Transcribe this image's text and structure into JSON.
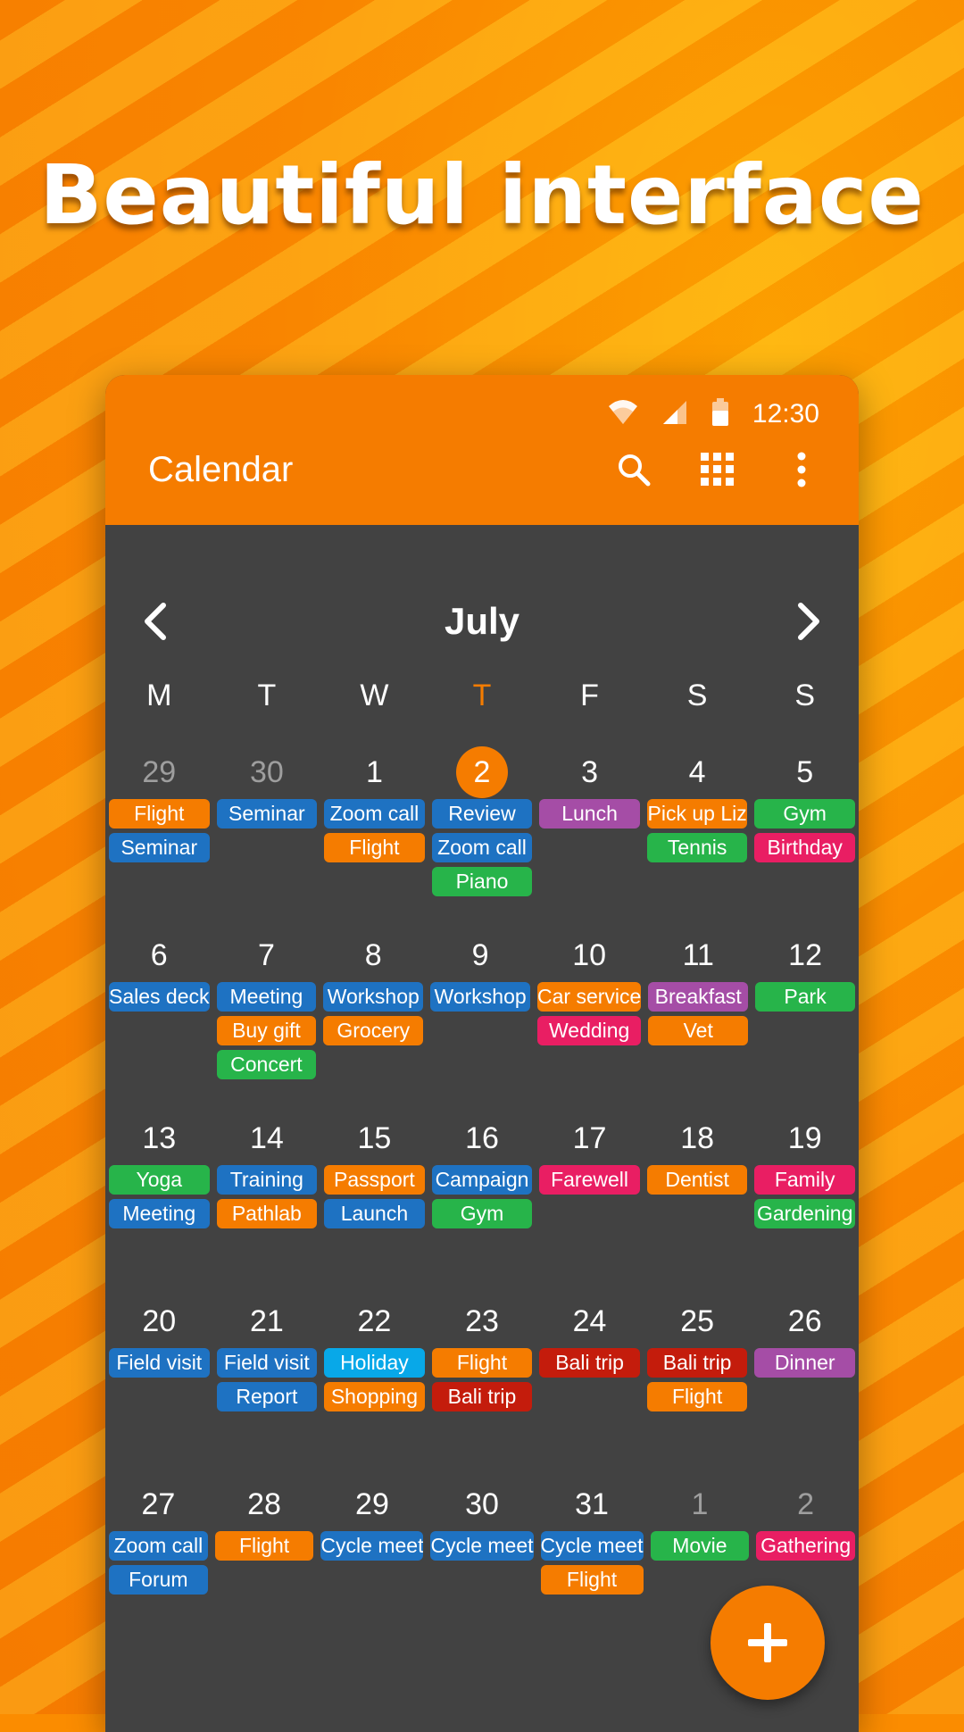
{
  "headline": "Beautiful interface",
  "status_bar": {
    "time": "12:30",
    "icons": [
      "wifi-icon",
      "signal-icon",
      "battery-icon"
    ]
  },
  "app_bar": {
    "title": "Calendar",
    "actions": [
      "search-icon",
      "grid-icon",
      "more-vert-icon"
    ]
  },
  "month": {
    "label": "July",
    "prev_icon": "chevron-left-icon",
    "next_icon": "chevron-right-icon"
  },
  "colors": {
    "accent": "#f57c00",
    "orange": "#f57c00",
    "blue": "#1e72c2",
    "green": "#27b44a",
    "purple": "#a54da6",
    "pink": "#e91e63",
    "red": "#c41c0c",
    "cyan": "#08a8e8",
    "background": "#424242"
  },
  "weekdays": [
    {
      "label": "M",
      "today": false
    },
    {
      "label": "T",
      "today": false
    },
    {
      "label": "W",
      "today": false
    },
    {
      "label": "T",
      "today": true
    },
    {
      "label": "F",
      "today": false
    },
    {
      "label": "S",
      "today": false
    },
    {
      "label": "S",
      "today": false
    }
  ],
  "weeks": [
    [
      {
        "day": "29",
        "muted": true,
        "events": [
          {
            "t": "Flight",
            "c": "orange"
          },
          {
            "t": "Seminar",
            "c": "blue"
          }
        ]
      },
      {
        "day": "30",
        "muted": true,
        "events": [
          {
            "t": "Seminar",
            "c": "blue"
          }
        ]
      },
      {
        "day": "1",
        "events": [
          {
            "t": "Zoom call",
            "c": "blue"
          },
          {
            "t": "Flight",
            "c": "orange"
          }
        ]
      },
      {
        "day": "2",
        "today": true,
        "events": [
          {
            "t": "Review",
            "c": "blue"
          },
          {
            "t": "Zoom call",
            "c": "blue"
          },
          {
            "t": "Piano",
            "c": "green"
          }
        ]
      },
      {
        "day": "3",
        "events": [
          {
            "t": "Lunch",
            "c": "purple"
          }
        ]
      },
      {
        "day": "4",
        "events": [
          {
            "t": "Pick up Liz",
            "c": "orange"
          },
          {
            "t": "Tennis",
            "c": "green"
          }
        ]
      },
      {
        "day": "5",
        "events": [
          {
            "t": "Gym",
            "c": "green"
          },
          {
            "t": "Birthday",
            "c": "pink"
          }
        ]
      }
    ],
    [
      {
        "day": "6",
        "events": [
          {
            "t": "Sales deck",
            "c": "blue"
          }
        ]
      },
      {
        "day": "7",
        "events": [
          {
            "t": "Meeting",
            "c": "blue"
          },
          {
            "t": "Buy gift",
            "c": "orange"
          },
          {
            "t": "Concert",
            "c": "green"
          }
        ]
      },
      {
        "day": "8",
        "events": [
          {
            "t": "Workshop",
            "c": "blue"
          },
          {
            "t": "Grocery",
            "c": "orange"
          }
        ]
      },
      {
        "day": "9",
        "events": [
          {
            "t": "Workshop",
            "c": "blue"
          }
        ]
      },
      {
        "day": "10",
        "events": [
          {
            "t": "Car service",
            "c": "orange"
          },
          {
            "t": "Wedding",
            "c": "pink"
          }
        ]
      },
      {
        "day": "11",
        "events": [
          {
            "t": "Breakfast",
            "c": "purple"
          },
          {
            "t": "Vet",
            "c": "orange"
          }
        ]
      },
      {
        "day": "12",
        "events": [
          {
            "t": "Park",
            "c": "green"
          }
        ]
      }
    ],
    [
      {
        "day": "13",
        "events": [
          {
            "t": "Yoga",
            "c": "green"
          },
          {
            "t": "Meeting",
            "c": "blue"
          }
        ]
      },
      {
        "day": "14",
        "events": [
          {
            "t": "Training",
            "c": "blue"
          },
          {
            "t": "Pathlab",
            "c": "orange"
          }
        ]
      },
      {
        "day": "15",
        "events": [
          {
            "t": "Passport",
            "c": "orange"
          },
          {
            "t": "Launch",
            "c": "blue"
          }
        ]
      },
      {
        "day": "16",
        "events": [
          {
            "t": "Campaign",
            "c": "blue"
          },
          {
            "t": "Gym",
            "c": "green"
          }
        ]
      },
      {
        "day": "17",
        "events": [
          {
            "t": "Farewell",
            "c": "pink"
          }
        ]
      },
      {
        "day": "18",
        "events": [
          {
            "t": "Dentist",
            "c": "orange"
          }
        ]
      },
      {
        "day": "19",
        "events": [
          {
            "t": "Family",
            "c": "pink"
          },
          {
            "t": "Gardening",
            "c": "green"
          }
        ]
      }
    ],
    [
      {
        "day": "20",
        "events": [
          {
            "t": "Field visit",
            "c": "blue"
          }
        ]
      },
      {
        "day": "21",
        "events": [
          {
            "t": "Field visit",
            "c": "blue"
          },
          {
            "t": "Report",
            "c": "blue"
          }
        ]
      },
      {
        "day": "22",
        "events": [
          {
            "t": "Holiday",
            "c": "cyan"
          },
          {
            "t": "Shopping",
            "c": "orange"
          }
        ]
      },
      {
        "day": "23",
        "events": [
          {
            "t": "Flight",
            "c": "orange"
          },
          {
            "t": "Bali trip",
            "c": "red"
          }
        ]
      },
      {
        "day": "24",
        "events": [
          {
            "t": "Bali trip",
            "c": "red"
          }
        ]
      },
      {
        "day": "25",
        "events": [
          {
            "t": "Bali trip",
            "c": "red"
          },
          {
            "t": "Flight",
            "c": "orange"
          }
        ]
      },
      {
        "day": "26",
        "events": [
          {
            "t": "Dinner",
            "c": "purple"
          }
        ]
      }
    ],
    [
      {
        "day": "27",
        "events": [
          {
            "t": "Zoom call",
            "c": "blue"
          },
          {
            "t": "Forum",
            "c": "blue"
          }
        ]
      },
      {
        "day": "28",
        "events": [
          {
            "t": "Flight",
            "c": "orange"
          }
        ]
      },
      {
        "day": "29",
        "events": [
          {
            "t": "Cycle meet",
            "c": "blue"
          }
        ]
      },
      {
        "day": "30",
        "events": [
          {
            "t": "Cycle meet",
            "c": "blue"
          }
        ]
      },
      {
        "day": "31",
        "events": [
          {
            "t": "Cycle meet",
            "c": "blue"
          },
          {
            "t": "Flight",
            "c": "orange"
          }
        ]
      },
      {
        "day": "1",
        "muted": true,
        "events": [
          {
            "t": "Movie",
            "c": "green"
          }
        ]
      },
      {
        "day": "2",
        "muted": true,
        "events": [
          {
            "t": "Gathering",
            "c": "pink"
          }
        ]
      }
    ]
  ],
  "fab": {
    "icon": "plus-icon"
  }
}
